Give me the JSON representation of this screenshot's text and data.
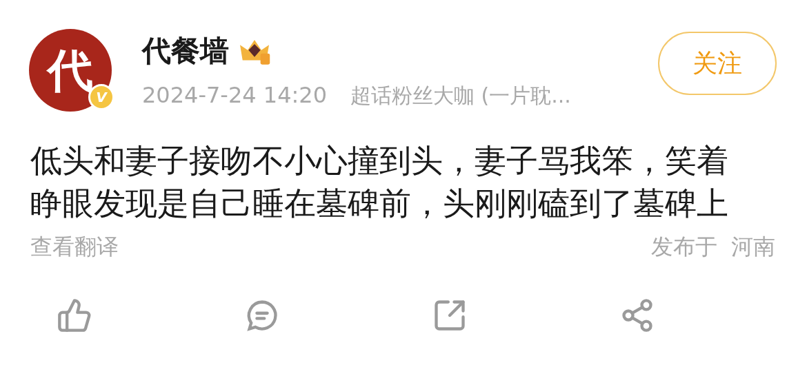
{
  "post": {
    "avatar_text": "代",
    "verified_mark": "V",
    "author": "代餐墙",
    "time": "2024-7-24 14:20",
    "meta": "超话粉丝大咖 (一片耽...",
    "follow_button": "关注",
    "text": "低头和妻子接吻不小心撞到头，妻子骂我笨，笑着睁眼发现是自己睡在墓碑前，头刚刚磕到了墓碑上",
    "translate_link": "查看翻译",
    "location": "发布于  河南"
  },
  "actions": [
    {
      "kind": "like"
    },
    {
      "kind": "comment"
    },
    {
      "kind": "repost"
    },
    {
      "kind": "share"
    }
  ]
}
